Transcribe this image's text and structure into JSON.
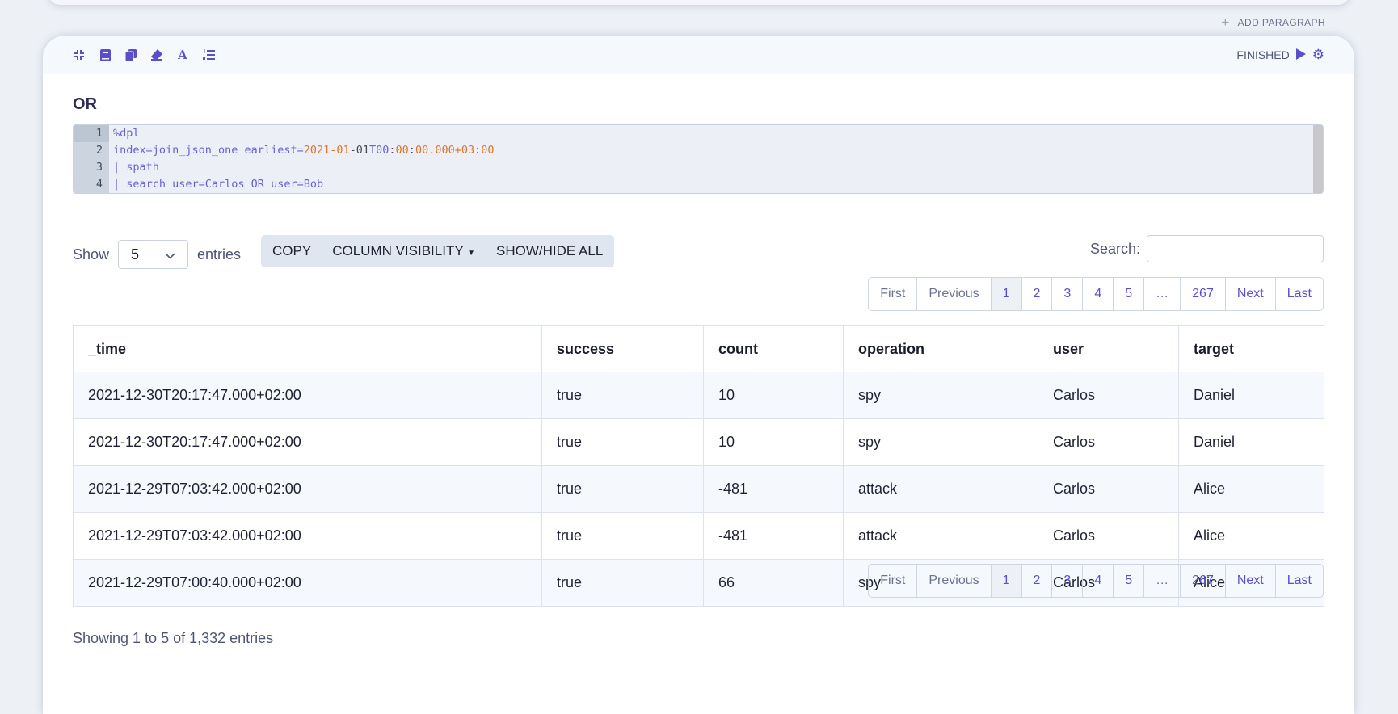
{
  "add_paragraph": "ADD PARAGRAPH",
  "paragraph": {
    "toolbar_icons": [
      "collapse-icon",
      "book-icon",
      "copy-icon",
      "eraser-icon",
      "font-icon",
      "list-ordered-icon"
    ],
    "status": "FINISHED",
    "title": "OR",
    "code_lines": [
      {
        "n": "1",
        "text": "%dpl"
      },
      {
        "n": "2",
        "a": "index=join_json_one earliest=",
        "b": "2021-01",
        "c": "-01",
        "d": "T00",
        ":1": ":",
        "e": "00",
        ":2": ":",
        "f": "00.000+03",
        ":3": ":",
        "g": "00"
      },
      {
        "n": "3",
        "text": "| spath"
      },
      {
        "n": "4",
        "text": "| search user=Carlos OR user=Bob"
      }
    ]
  },
  "table_controls": {
    "show_label": "Show",
    "entries_value": "5",
    "entries_label": "entries",
    "copy": "COPY",
    "column_visibility": "COLUMN VISIBILITY",
    "show_hide_all": "SHOW/HIDE ALL",
    "search_label": "Search:",
    "search_value": ""
  },
  "pagination": [
    "First",
    "Previous",
    "1",
    "2",
    "3",
    "4",
    "5",
    "…",
    "267",
    "Next",
    "Last"
  ],
  "table": {
    "columns": [
      "_time",
      "success",
      "count",
      "operation",
      "user",
      "target"
    ],
    "rows": [
      [
        "2021-12-30T20:17:47.000+02:00",
        "true",
        "10",
        "spy",
        "Carlos",
        "Daniel"
      ],
      [
        "2021-12-30T20:17:47.000+02:00",
        "true",
        "10",
        "spy",
        "Carlos",
        "Daniel"
      ],
      [
        "2021-12-29T07:03:42.000+02:00",
        "true",
        "-481",
        "attack",
        "Carlos",
        "Alice"
      ],
      [
        "2021-12-29T07:03:42.000+02:00",
        "true",
        "-481",
        "attack",
        "Carlos",
        "Alice"
      ],
      [
        "2021-12-29T07:00:40.000+02:00",
        "true",
        "66",
        "spy",
        "Carlos",
        "Alice"
      ]
    ]
  },
  "info": "Showing 1 to 5 of 1,332 entries"
}
